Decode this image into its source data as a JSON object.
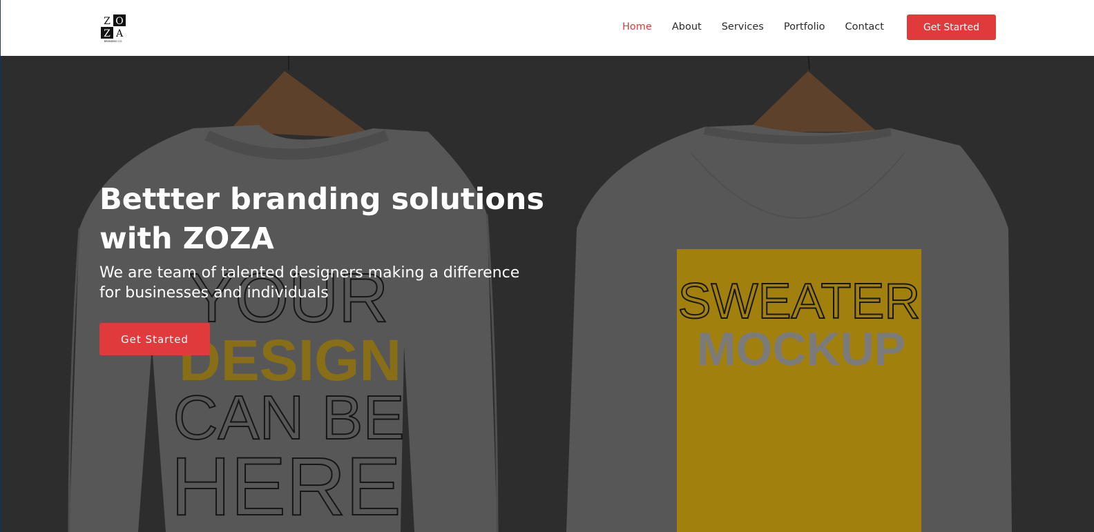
{
  "brand": {
    "logo_letters": [
      "Z",
      "O",
      "Z",
      "A"
    ],
    "logo_tagline": "BRANDING CO."
  },
  "nav": {
    "items": [
      {
        "label": "Home",
        "active": true
      },
      {
        "label": "About",
        "active": false
      },
      {
        "label": "Services",
        "active": false
      },
      {
        "label": "Portfolio",
        "active": false
      },
      {
        "label": "Contact",
        "active": false
      }
    ],
    "cta_label": "Get Started"
  },
  "hero": {
    "title": "Bettter branding solutions with ZOZA",
    "subtitle": "We are team of talented designers making a difference for businesses and individuals",
    "cta_label": "Get Started",
    "front_print": [
      "YOUR",
      "DESIGN",
      "CAN BE",
      "HERE"
    ],
    "back_print": [
      "SWEATER",
      "MOCKUP"
    ]
  },
  "colors": {
    "accent": "#e03a3c",
    "hero_bg": "#343434",
    "sweater": "#646464",
    "print_gold": "#b8920f"
  }
}
